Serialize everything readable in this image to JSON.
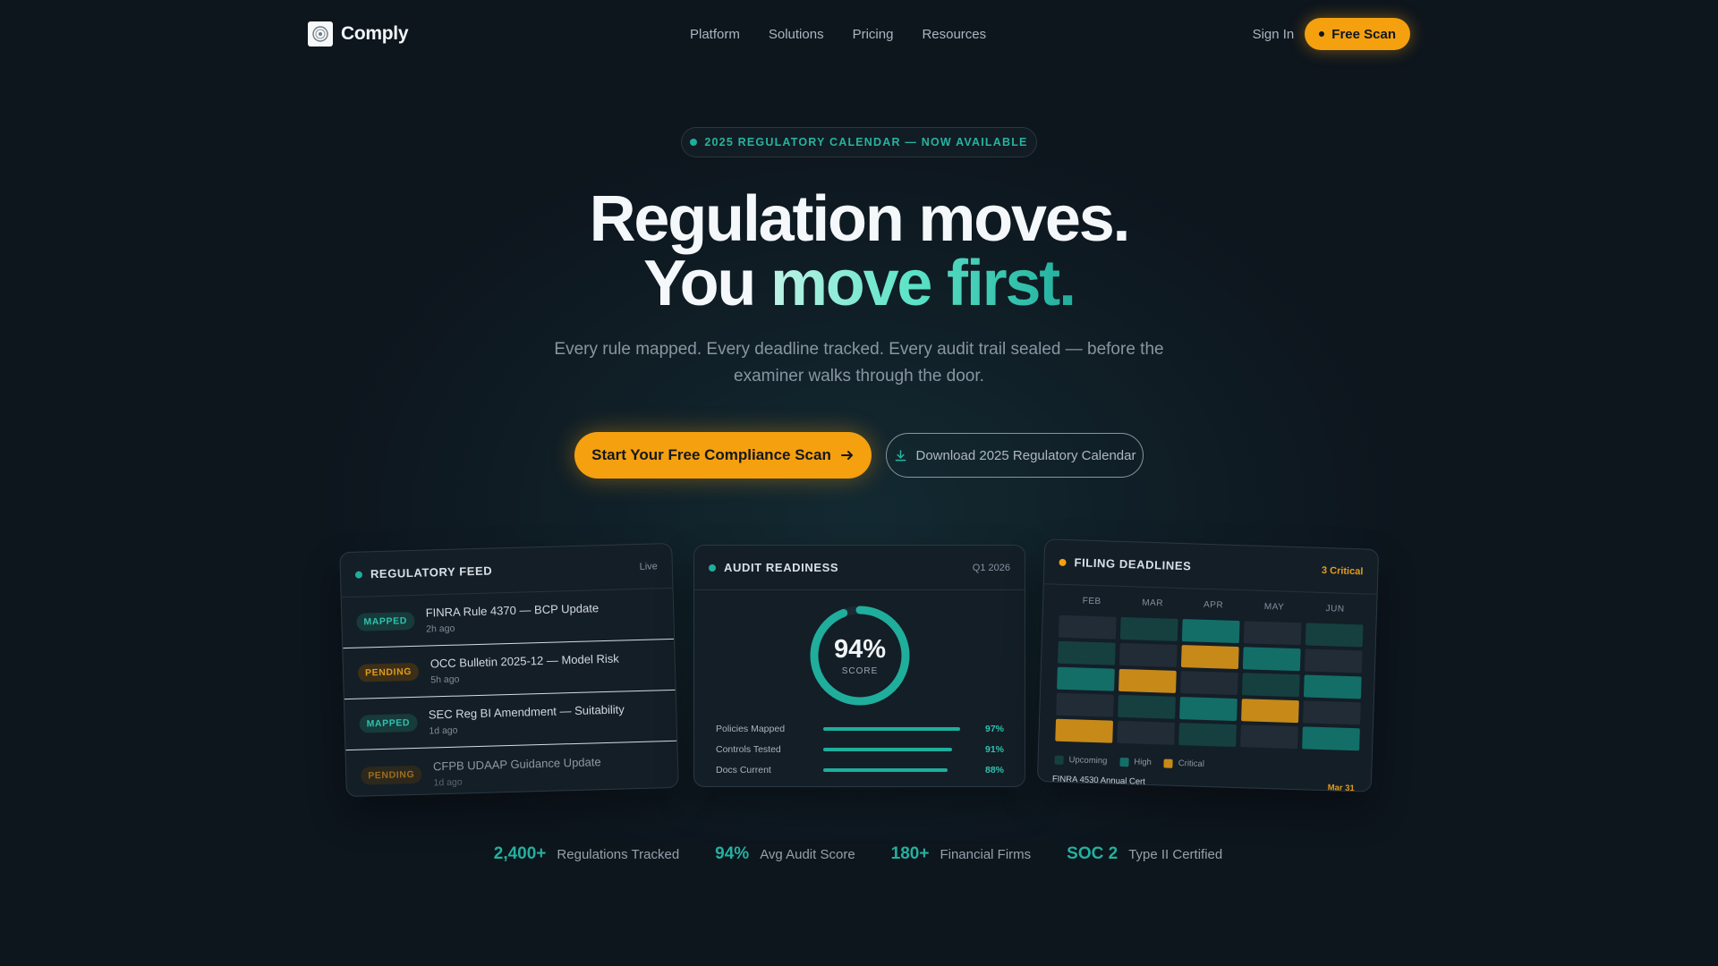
{
  "nav": {
    "brand": "Comply",
    "links": [
      "Platform",
      "Solutions",
      "Pricing",
      "Resources"
    ],
    "sign_in": "Sign In",
    "free_scan": "Free Scan"
  },
  "hero": {
    "badge": "2025 REGULATORY CALENDAR — NOW AVAILABLE",
    "headline_line1": "Regulation moves.",
    "headline_line2_plain": "You ",
    "headline_line2_accent": "move first.",
    "subtitle": "Every rule mapped. Every deadline tracked. Every audit trail sealed — before the examiner walks through the door.",
    "primary_cta": "Start Your Free Compliance Scan",
    "secondary_cta": "Download 2025 Regulatory Calendar"
  },
  "regulatory_feed": {
    "title": "REGULATORY FEED",
    "status": "Live",
    "items": [
      {
        "badge": "MAPPED",
        "kind": "mapped",
        "name": "FINRA Rule 4370 — BCP Update",
        "age": "2h ago"
      },
      {
        "badge": "PENDING",
        "kind": "pending",
        "name": "OCC Bulletin 2025-12 — Model Risk",
        "age": "5h ago"
      },
      {
        "badge": "MAPPED",
        "kind": "mapped",
        "name": "SEC Reg BI Amendment — Suitability",
        "age": "1d ago"
      },
      {
        "badge": "PENDING",
        "kind": "pending",
        "name": "CFPB UDAAP Guidance Update",
        "age": "1d ago"
      }
    ]
  },
  "audit_readiness": {
    "title": "AUDIT READINESS",
    "period": "Q1 2026",
    "score_value": 0.94,
    "score_text": "94%",
    "score_label": "SCORE",
    "metrics": [
      {
        "label": "Policies Mapped",
        "value": 0.97,
        "text": "97%"
      },
      {
        "label": "Controls Tested",
        "value": 0.91,
        "text": "91%"
      },
      {
        "label": "Docs Current",
        "value": 0.88,
        "text": "88%"
      }
    ]
  },
  "filing_deadlines": {
    "title": "FILING DEADLINES",
    "critical_count": "3 Critical",
    "months": [
      "FEB",
      "MAR",
      "APR",
      "MAY",
      "JUN"
    ],
    "grid": [
      [
        "e",
        "u",
        "h",
        "e",
        "u"
      ],
      [
        "u",
        "e",
        "c",
        "h",
        "e"
      ],
      [
        "h",
        "c",
        "e",
        "u",
        "h"
      ],
      [
        "e",
        "u",
        "h",
        "c",
        "e"
      ],
      [
        "c",
        "e",
        "u",
        "e",
        "h"
      ]
    ],
    "legend": [
      {
        "label": "Upcoming",
        "color": "#15403f"
      },
      {
        "label": "High",
        "color": "#136e68"
      },
      {
        "label": "Critical",
        "color": "#c78918"
      }
    ],
    "footer_text": "FINRA 4530 Annual Cert",
    "footer_date": "Mar 31"
  },
  "stats": [
    {
      "value": "2,400+",
      "label": "Regulations Tracked"
    },
    {
      "value": "94%",
      "label": "Avg Audit Score"
    },
    {
      "value": "180+",
      "label": "Financial Firms"
    },
    {
      "value": "SOC 2",
      "label": "Type II Certified"
    }
  ],
  "colors": {
    "background": "#0d151d",
    "accent_teal": "#1fae9c",
    "accent_amber": "#f5a00f"
  }
}
